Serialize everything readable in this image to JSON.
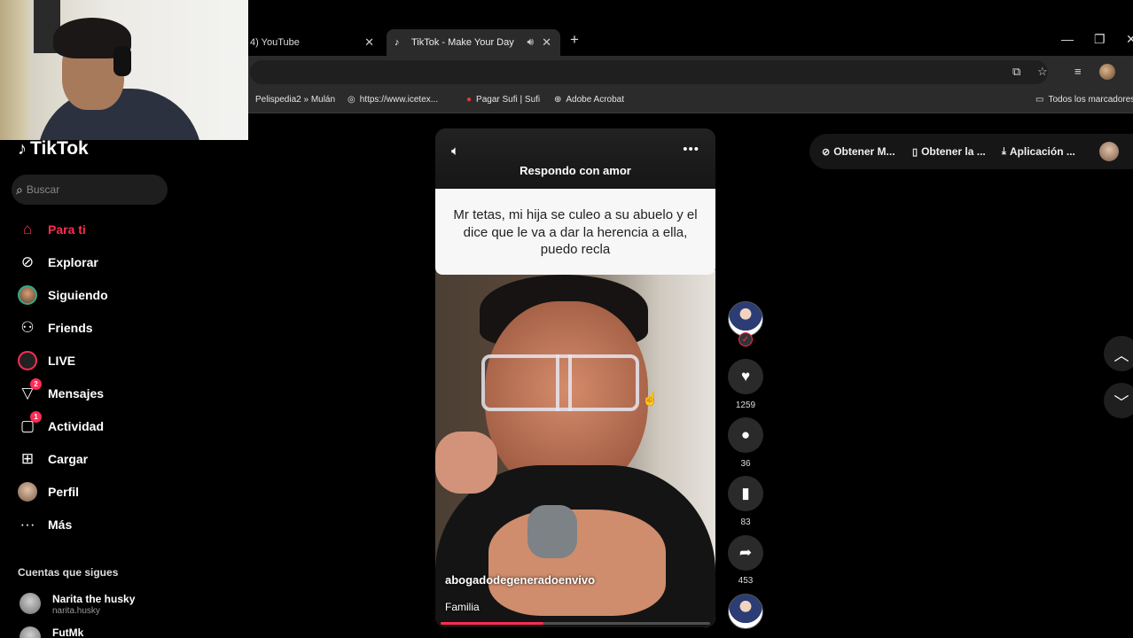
{
  "browser": {
    "tabs": [
      {
        "title": "4) YouTube"
      },
      {
        "title": "TikTok - Make Your Day"
      }
    ],
    "bookmarks": [
      {
        "label": "Pelispedia2 » Mulán"
      },
      {
        "label": "https://www.icetex..."
      },
      {
        "label": "Pagar Sufi | Sufi"
      },
      {
        "label": "Adobe Acrobat"
      },
      {
        "label": "Todos los marcadores"
      }
    ]
  },
  "tiktok": {
    "logo": "TikTok",
    "search_placeholder": "Buscar",
    "nav": [
      {
        "label": "Para ti",
        "icon": "home-icon",
        "active": true
      },
      {
        "label": "Explorar",
        "icon": "compass-icon"
      },
      {
        "label": "Siguiendo",
        "icon": "following-avatar-icon"
      },
      {
        "label": "Friends",
        "icon": "friends-icon"
      },
      {
        "label": "LIVE",
        "icon": "live-icon"
      },
      {
        "label": "Mensajes",
        "icon": "messages-icon",
        "badge": "2"
      },
      {
        "label": "Actividad",
        "icon": "activity-icon",
        "badge": "1"
      },
      {
        "label": "Cargar",
        "icon": "upload-icon"
      },
      {
        "label": "Perfil",
        "icon": "profile-avatar"
      },
      {
        "label": "Más",
        "icon": "more-icon"
      }
    ],
    "following_heading": "Cuentas que sigues",
    "following": [
      {
        "name": "Narita the husky",
        "handle": "narita.husky"
      },
      {
        "name": "FutMk",
        "handle": ""
      }
    ],
    "topbar": {
      "get_mobile": "Obtener M...",
      "get_app": "Obtener la ...",
      "app": "Aplicación ..."
    },
    "video": {
      "reply_title": "Respondo con amor",
      "question": "Mr tetas, mi hija se culeo a su abuelo y el dice que le va a dar la herencia a ella, puedo recla",
      "author": "abogadodegeneradoenvivo",
      "tag": "Familia",
      "progress": 0.38
    },
    "actions": {
      "likes": "1259",
      "comments": "36",
      "saves": "83",
      "shares": "453"
    }
  },
  "colors": {
    "accent": "#fe2c55",
    "background": "#000000"
  }
}
